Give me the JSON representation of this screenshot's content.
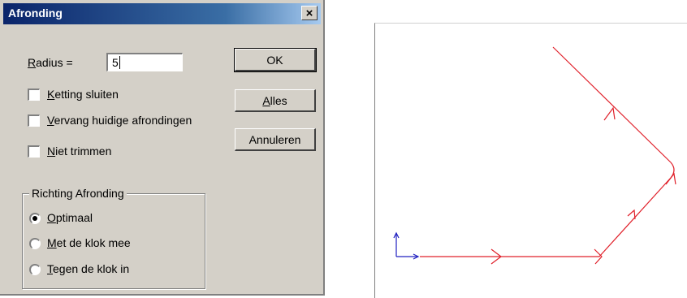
{
  "dialog": {
    "title": "Afronding",
    "close_glyph": "×",
    "radius_label": "Radius =",
    "radius_value": "5",
    "checkboxes": [
      {
        "label": "Ketting sluiten",
        "checked": false
      },
      {
        "label": "Vervang huidige afrondingen",
        "checked": false
      },
      {
        "label": "Niet trimmen",
        "checked": false
      }
    ],
    "buttons": {
      "ok": "OK",
      "alles": "Alles",
      "annuleren": "Annuleren"
    },
    "direction_group": {
      "legend": "Richting Afronding",
      "options": [
        {
          "label": "Optimaal",
          "selected": true
        },
        {
          "label": "Met de klok mee",
          "selected": false
        },
        {
          "label": "Tegen de klok in",
          "selected": false
        }
      ]
    }
  },
  "canvas": {
    "path_color": "#e0202a",
    "axis_color": "#2020c0",
    "icons": [
      "origin-axis-icon",
      "direction-arrow-icon"
    ]
  }
}
